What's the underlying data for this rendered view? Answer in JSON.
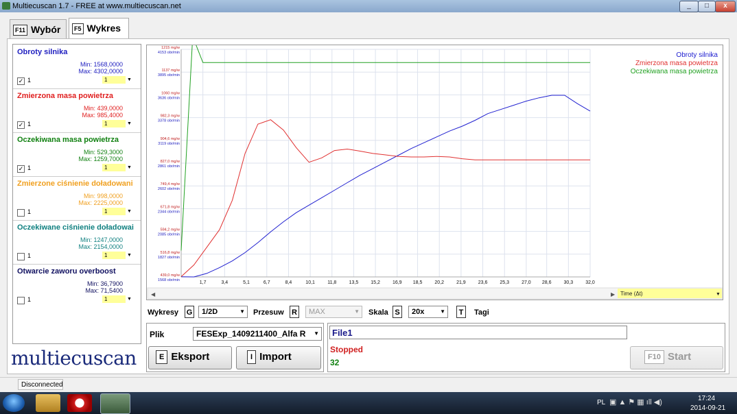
{
  "window": {
    "title": "Multiecuscan 1.7 - FREE at www.multiecuscan.net",
    "minimize": "_",
    "maximize": "□",
    "close": "x"
  },
  "tabs": [
    {
      "key": "F11",
      "label": "Wybór"
    },
    {
      "key": "F5",
      "label": "Wykres"
    }
  ],
  "channels": [
    {
      "name": "Obroty silnika",
      "min": "Min: 1568,0000",
      "max": "Max: 4302,0000",
      "checked": "✓",
      "idx": "1",
      "sel": "1",
      "color": "#2020c0"
    },
    {
      "name": "Zmierzona masa powietrza",
      "min": "Min: 439,0000",
      "max": "Max: 985,4000",
      "checked": "✓",
      "idx": "1",
      "sel": "1",
      "color": "#e02020"
    },
    {
      "name": "Oczekiwana masa powietrza",
      "min": "Min: 529,3000",
      "max": "Max: 1259,7000",
      "checked": "✓",
      "idx": "1",
      "sel": "1",
      "color": "#108010"
    },
    {
      "name": "Zmierzone ciśnienie doładowani",
      "min": "Min: 998,0000",
      "max": "Max: 2225,0000",
      "checked": "",
      "idx": "1",
      "sel": "1",
      "color": "#f0a020"
    },
    {
      "name": "Oczekiwane ciśnienie doładowai",
      "min": "Min: 1247,0000",
      "max": "Max: 2154,0000",
      "checked": "",
      "idx": "1",
      "sel": "1",
      "color": "#108080"
    },
    {
      "name": "Otwarcie zaworu overboost",
      "min": "Min: 36,7900",
      "max": "Max: 71,5400",
      "checked": "",
      "idx": "1",
      "sel": "1",
      "color": "#101060"
    }
  ],
  "logo": "multiecuscan",
  "chart_data": {
    "type": "line",
    "x_ticks": [
      "1,7",
      "3,4",
      "5,1",
      "6,7",
      "8,4",
      "10,1",
      "11,8",
      "13,5",
      "15,2",
      "16,9",
      "18,5",
      "20,2",
      "21,9",
      "23,6",
      "25,3",
      "27,0",
      "28,6",
      "30,3",
      "32,0"
    ],
    "xlim": [
      0,
      32
    ],
    "x_axis_label": "Time (Δt)",
    "y_ticks_mg": [
      "439,0 mg/w",
      "516,8 mg/w",
      "594,2 mg/w",
      "671,8 mg/w",
      "749,4 mg/w",
      "827,0 mg/w",
      "904,6 mg/w",
      "982,3 mg/w",
      "1060 mg/w",
      "1137 mg/w",
      "1215 mg/w"
    ],
    "y_ticks_rpm": [
      "1568 obr/min",
      "1827 obr/min",
      "2085 obr/min",
      "2344 obr/min",
      "2602 obr/min",
      "2861 obr/min",
      "3119 obr/min",
      "3378 obr/min",
      "3636 obr/min",
      "3895 obr/min",
      "4153 obr/min"
    ],
    "legend": [
      "Obroty silnika",
      "Zmierzona masa powietrza",
      "Oczekiwana masa powietrza"
    ],
    "legend_position": "top-right",
    "grid": true,
    "series": [
      {
        "name": "Obroty silnika",
        "color": "#2020d0",
        "unit": "obr/min",
        "ylim": [
          1568,
          4302
        ],
        "x": [
          0,
          1,
          2,
          3,
          4,
          5,
          6,
          7,
          8,
          9,
          10,
          11,
          12,
          13,
          14,
          15,
          16,
          17,
          18,
          19,
          20,
          21,
          22,
          23,
          24,
          25,
          26,
          27,
          28,
          29,
          30,
          31,
          32
        ],
        "y": [
          1570,
          1568,
          1610,
          1680,
          1760,
          1860,
          1980,
          2110,
          2230,
          2340,
          2430,
          2520,
          2610,
          2700,
          2790,
          2870,
          2950,
          3030,
          3110,
          3180,
          3250,
          3320,
          3380,
          3450,
          3530,
          3580,
          3630,
          3680,
          3720,
          3750,
          3750,
          3650,
          3560
        ]
      },
      {
        "name": "Zmierzona masa powietrza",
        "color": "#e03030",
        "unit": "mg/w",
        "ylim": [
          439,
          1215
        ],
        "x": [
          0,
          1,
          2,
          3,
          4,
          5,
          6,
          7,
          8,
          9,
          10,
          11,
          12,
          13,
          14,
          15,
          16,
          17,
          18,
          19,
          20,
          21,
          22,
          23,
          24,
          25,
          26,
          27,
          28,
          29,
          30,
          31,
          32
        ],
        "y": [
          440,
          480,
          540,
          600,
          700,
          860,
          960,
          975,
          940,
          880,
          830,
          845,
          870,
          875,
          868,
          860,
          855,
          850,
          848,
          848,
          850,
          848,
          842,
          838,
          838,
          838,
          838,
          838,
          838,
          838,
          838,
          838,
          838
        ]
      },
      {
        "name": "Oczekiwana masa powietrza",
        "color": "#20a020",
        "unit": "mg/w",
        "ylim": [
          439,
          1215
        ],
        "x": [
          0,
          0.9,
          1.7,
          4,
          8,
          12,
          16,
          20,
          24,
          28,
          32
        ],
        "y": [
          529,
          1259,
          1170,
          1170,
          1170,
          1170,
          1170,
          1170,
          1170,
          1170,
          1170
        ]
      }
    ]
  },
  "controls": {
    "wykresy_label": "Wykresy",
    "wykresy_key": "G",
    "wykresy_value": "1/2D",
    "przesuw_label": "Przesuw",
    "przesuw_key": "R",
    "przesuw_value": "MAX",
    "skala_label": "Skala",
    "skala_key": "S",
    "skala_value": "20x",
    "tagi_key": "T",
    "tagi_label": "Tagi"
  },
  "file": {
    "label": "Plik",
    "value": "FESExp_1409211400_Alfa R",
    "export_key": "E",
    "export_label": "Eksport",
    "import_key": "I",
    "import_label": "Import"
  },
  "status": {
    "file_name": "File1",
    "state": "Stopped",
    "count": "32",
    "start_key": "F10",
    "start_label": "Start"
  },
  "statusbar": {
    "connection": "Disconnected"
  },
  "taskbar": {
    "lang": "PL",
    "time": "17:24",
    "date": "2014-09-21"
  }
}
